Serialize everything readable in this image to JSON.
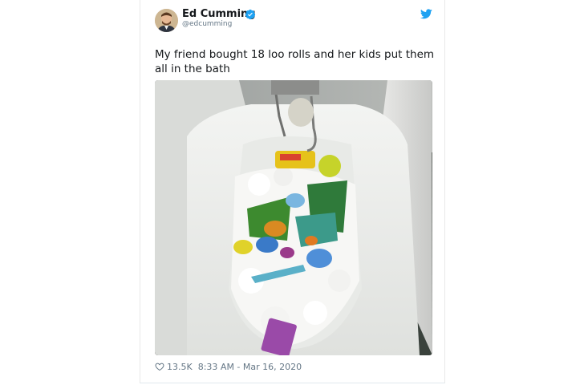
{
  "tweet": {
    "author_name": "Ed Cumming",
    "author_handle": "@edcumming",
    "text": "My friend bought 18 loo rolls and her kids put them all in the bath",
    "likes": "13.5K",
    "timestamp": "8:33 AM - Mar 16, 2020"
  },
  "colors": {
    "twitter_blue": "#1da1f2",
    "text_primary": "#14171a",
    "text_secondary": "#657786"
  },
  "icons": {
    "verified": "verified-badge-icon",
    "brand": "twitter-bird-icon",
    "like": "heart-icon"
  }
}
